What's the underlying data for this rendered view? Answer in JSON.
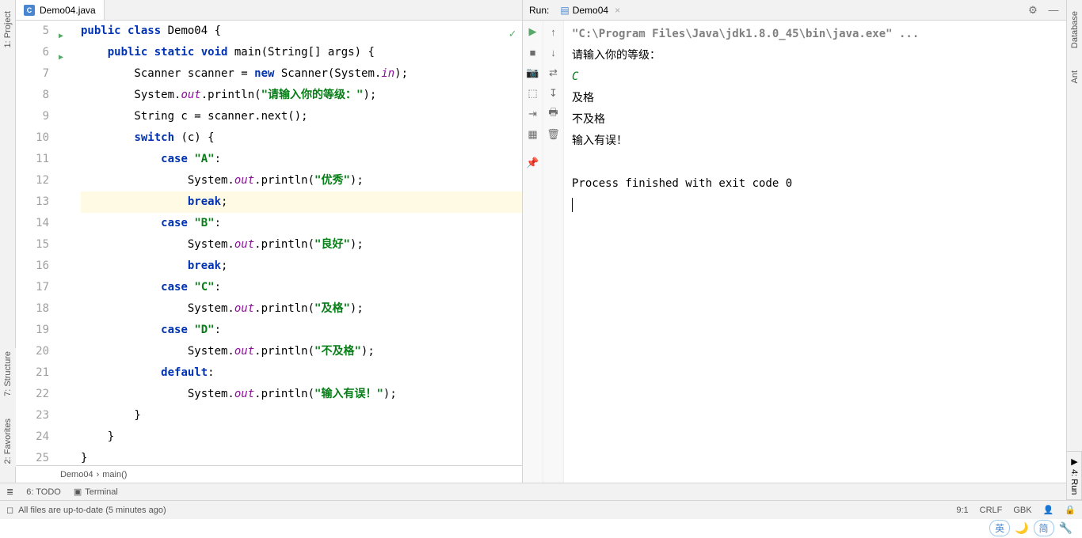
{
  "sidebar_left": {
    "project": "1: Project",
    "structure": "7: Structure",
    "favorites": "2: Favorites"
  },
  "sidebar_right": {
    "database": "Database",
    "ant": "Ant"
  },
  "editor": {
    "tab_label": "Demo04.java",
    "line_start": 5,
    "lines": [
      [
        [
          "kw",
          "public class"
        ],
        [
          "cls",
          " Demo04 {"
        ]
      ],
      [
        [
          "",
          "    "
        ],
        [
          "kw",
          "public static void"
        ],
        [
          "cls",
          " main(String[] args) {"
        ]
      ],
      [
        [
          "",
          "        Scanner scanner = "
        ],
        [
          "kw",
          "new"
        ],
        [
          "",
          " Scanner(System."
        ],
        [
          "fld",
          "in"
        ],
        [
          "",
          ");"
        ]
      ],
      [
        [
          "",
          "        System."
        ],
        [
          "fld",
          "out"
        ],
        [
          "",
          ".println("
        ],
        [
          "str",
          "\"请输入你的等级：\""
        ],
        [
          "",
          ");"
        ]
      ],
      [
        [
          "",
          "        String c = scanner.next();"
        ]
      ],
      [
        [
          "",
          "        "
        ],
        [
          "kw",
          "switch"
        ],
        [
          "",
          " (c) {"
        ]
      ],
      [
        [
          "",
          "            "
        ],
        [
          "kw",
          "case"
        ],
        [
          "",
          " "
        ],
        [
          "str",
          "\"A\""
        ],
        [
          "",
          ":"
        ]
      ],
      [
        [
          "",
          "                System."
        ],
        [
          "fld",
          "out"
        ],
        [
          "",
          ".println("
        ],
        [
          "str",
          "\"优秀\""
        ],
        [
          "",
          ");"
        ]
      ],
      [
        [
          "",
          "                "
        ],
        [
          "kw",
          "break"
        ],
        [
          "",
          ";"
        ]
      ],
      [
        [
          "",
          "            "
        ],
        [
          "kw",
          "case"
        ],
        [
          "",
          " "
        ],
        [
          "str",
          "\"B\""
        ],
        [
          "",
          ":"
        ]
      ],
      [
        [
          "",
          "                System."
        ],
        [
          "fld",
          "out"
        ],
        [
          "",
          ".println("
        ],
        [
          "str",
          "\"良好\""
        ],
        [
          "",
          ");"
        ]
      ],
      [
        [
          "",
          "                "
        ],
        [
          "kw",
          "break"
        ],
        [
          "",
          ";"
        ]
      ],
      [
        [
          "",
          "            "
        ],
        [
          "kw",
          "case"
        ],
        [
          "",
          " "
        ],
        [
          "str",
          "\"C\""
        ],
        [
          "",
          ":"
        ]
      ],
      [
        [
          "",
          "                System."
        ],
        [
          "fld",
          "out"
        ],
        [
          "",
          ".println("
        ],
        [
          "str",
          "\"及格\""
        ],
        [
          "",
          ");"
        ]
      ],
      [
        [
          "",
          "            "
        ],
        [
          "kw",
          "case"
        ],
        [
          "",
          " "
        ],
        [
          "str",
          "\"D\""
        ],
        [
          "",
          ":"
        ]
      ],
      [
        [
          "",
          "                System."
        ],
        [
          "fld",
          "out"
        ],
        [
          "",
          ".println("
        ],
        [
          "str",
          "\"不及格\""
        ],
        [
          "",
          ");"
        ]
      ],
      [
        [
          "",
          "            "
        ],
        [
          "kw",
          "default"
        ],
        [
          "",
          ":"
        ]
      ],
      [
        [
          "",
          "                System."
        ],
        [
          "fld",
          "out"
        ],
        [
          "",
          ".println("
        ],
        [
          "str",
          "\"输入有误！\""
        ],
        [
          "",
          ");"
        ]
      ],
      [
        [
          "",
          "        }"
        ]
      ],
      [
        [
          "",
          "    }"
        ]
      ],
      [
        [
          "",
          "}"
        ]
      ],
      [
        [
          "",
          ""
        ]
      ]
    ],
    "highlight_line": 13,
    "breadcrumb": [
      "Demo04",
      "main()"
    ]
  },
  "run": {
    "label": "Run:",
    "tab": "Demo04",
    "cmd": "\"C:\\Program Files\\Java\\jdk1.8.0_45\\bin\\java.exe\" ...",
    "lines": [
      "请输入你的等级：",
      "C",
      "及格",
      "不及格",
      "输入有误！",
      "",
      "Process finished with exit code 0"
    ],
    "input_line_index": 1,
    "exit_line_index": 6
  },
  "bottom": {
    "todo": "6: TODO",
    "terminal": "Terminal",
    "run_tab": "4: Run"
  },
  "status": {
    "msg": "All files are up-to-date (5 minutes ago)",
    "pos": "9:1",
    "eol": "CRLF",
    "enc": "GBK"
  },
  "ime": {
    "lang": "英",
    "mode": "简"
  }
}
